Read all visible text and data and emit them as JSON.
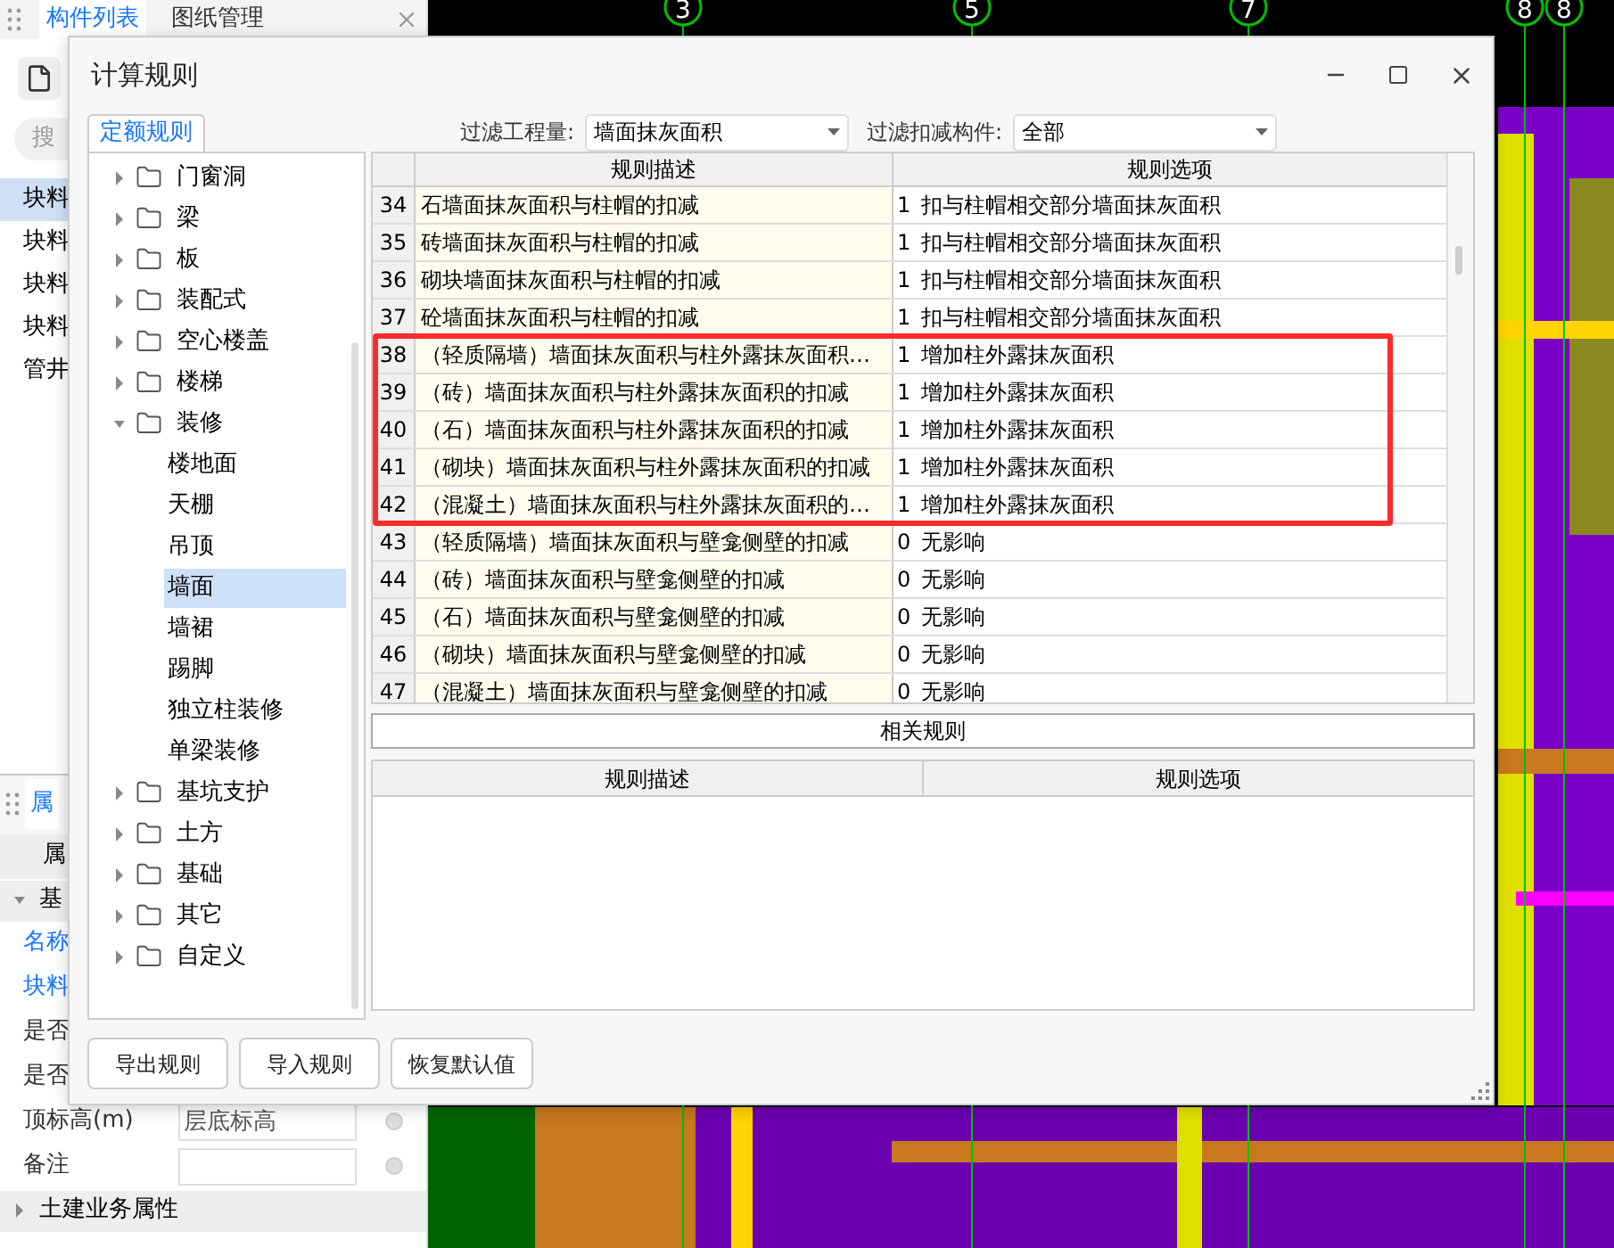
{
  "left_panel": {
    "tabs": [
      {
        "label": "构件列表",
        "selected": true
      },
      {
        "label": "图纸管理",
        "selected": false
      }
    ],
    "search": {
      "placeholder": "搜"
    },
    "items": [
      {
        "label": "块料",
        "selected": true
      },
      {
        "label": "块料",
        "selected": false
      },
      {
        "label": "块料",
        "selected": false
      },
      {
        "label": "块料",
        "selected": false
      },
      {
        "label": "管井",
        "selected": false
      }
    ]
  },
  "properties": {
    "tab": "属",
    "header": "属",
    "groups": [
      {
        "label": "基",
        "expanded": true,
        "rows": [
          {
            "kind": "text",
            "name": "名称",
            "emphasized": true
          },
          {
            "kind": "text",
            "name": "块料",
            "emphasized": true
          },
          {
            "kind": "text",
            "name": "是否",
            "emphasized": false
          },
          {
            "kind": "text",
            "name": "是否",
            "emphasized": false
          },
          {
            "kind": "field",
            "name": "顶标高(m)",
            "value": "层底标高",
            "emphasized": false
          },
          {
            "kind": "field",
            "name": "备注",
            "emphasized": false
          }
        ]
      },
      {
        "label": "土建业务属性",
        "expanded": false
      }
    ]
  },
  "canvas": {
    "axis_labels": [
      "3",
      "5",
      "7",
      "8",
      "8"
    ]
  },
  "dialog": {
    "title": "计算规则",
    "tabs": [
      {
        "label": "定额规则",
        "selected": true
      }
    ],
    "tree": [
      {
        "kind": "folder",
        "label": "门窗洞",
        "expanded": false
      },
      {
        "kind": "folder",
        "label": "梁",
        "expanded": false
      },
      {
        "kind": "folder",
        "label": "板",
        "expanded": false
      },
      {
        "kind": "folder",
        "label": "装配式",
        "expanded": false
      },
      {
        "kind": "folder",
        "label": "空心楼盖",
        "expanded": false
      },
      {
        "kind": "folder",
        "label": "楼梯",
        "expanded": false
      },
      {
        "kind": "folder",
        "label": "装修",
        "expanded": true,
        "children": [
          {
            "kind": "leaf",
            "label": "楼地面",
            "selected": false
          },
          {
            "kind": "leaf",
            "label": "天棚",
            "selected": false
          },
          {
            "kind": "leaf",
            "label": "吊顶",
            "selected": false
          },
          {
            "kind": "leaf",
            "label": "墙面",
            "selected": true
          },
          {
            "kind": "leaf",
            "label": "墙裙",
            "selected": false
          },
          {
            "kind": "leaf",
            "label": "踢脚",
            "selected": false
          },
          {
            "kind": "leaf",
            "label": "独立柱装修",
            "selected": false
          },
          {
            "kind": "leaf",
            "label": "单梁装修",
            "selected": false
          }
        ]
      },
      {
        "kind": "folder",
        "label": "基坑支护",
        "expanded": false
      },
      {
        "kind": "folder",
        "label": "土方",
        "expanded": false
      },
      {
        "kind": "folder",
        "label": "基础",
        "expanded": false
      },
      {
        "kind": "folder",
        "label": "其它",
        "expanded": false
      },
      {
        "kind": "folder",
        "label": "自定义",
        "expanded": false
      }
    ],
    "filters": [
      {
        "label": "过滤工程量:",
        "value": "墙面抹灰面积"
      },
      {
        "label": "过滤扣减构件:",
        "value": "全部"
      }
    ],
    "rules_table": {
      "columns": [
        "规则描述",
        "规则选项"
      ],
      "rows": [
        {
          "index": "34",
          "description": "石墙面抹灰面积与柱帽的扣减",
          "code": "1",
          "option": "扣与柱帽相交部分墙面抹灰面积"
        },
        {
          "index": "35",
          "description": "砖墙面抹灰面积与柱帽的扣减",
          "code": "1",
          "option": "扣与柱帽相交部分墙面抹灰面积"
        },
        {
          "index": "36",
          "description": "砌块墙面抹灰面积与柱帽的扣减",
          "code": "1",
          "option": "扣与柱帽相交部分墙面抹灰面积"
        },
        {
          "index": "37",
          "description": "砼墙面抹灰面积与柱帽的扣减",
          "code": "1",
          "option": "扣与柱帽相交部分墙面抹灰面积"
        },
        {
          "index": "38",
          "description": "（轻质隔墙）墙面抹灰面积与柱外露抹灰面积…",
          "code": "1",
          "option": "增加柱外露抹灰面积"
        },
        {
          "index": "39",
          "description": "（砖）墙面抹灰面积与柱外露抹灰面积的扣减",
          "code": "1",
          "option": "增加柱外露抹灰面积"
        },
        {
          "index": "40",
          "description": "（石）墙面抹灰面积与柱外露抹灰面积的扣减",
          "code": "1",
          "option": "增加柱外露抹灰面积"
        },
        {
          "index": "41",
          "description": "（砌块）墙面抹灰面积与柱外露抹灰面积的扣减",
          "code": "1",
          "option": "增加柱外露抹灰面积"
        },
        {
          "index": "42",
          "description": "（混凝土）墙面抹灰面积与柱外露抹灰面积的…",
          "code": "1",
          "option": "增加柱外露抹灰面积"
        },
        {
          "index": "43",
          "description": "（轻质隔墙）墙面抹灰面积与壁龛侧壁的扣减",
          "code": "0",
          "option": "无影响"
        },
        {
          "index": "44",
          "description": "（砖）墙面抹灰面积与壁龛侧壁的扣减",
          "code": "0",
          "option": "无影响"
        },
        {
          "index": "45",
          "description": "（石）墙面抹灰面积与壁龛侧壁的扣减",
          "code": "0",
          "option": "无影响"
        },
        {
          "index": "46",
          "description": "（砌块）墙面抹灰面积与壁龛侧壁的扣减",
          "code": "0",
          "option": "无影响"
        },
        {
          "index": "47",
          "description": "（混凝土）墙面抹灰面积与壁龛侧壁的扣减",
          "code": "0",
          "option": "无影响"
        }
      ]
    },
    "related_rules": {
      "title": "相关规则",
      "columns": [
        "规则描述",
        "规则选项"
      ]
    },
    "buttons": [
      "导出规则",
      "导入规则",
      "恢复默认值"
    ]
  }
}
